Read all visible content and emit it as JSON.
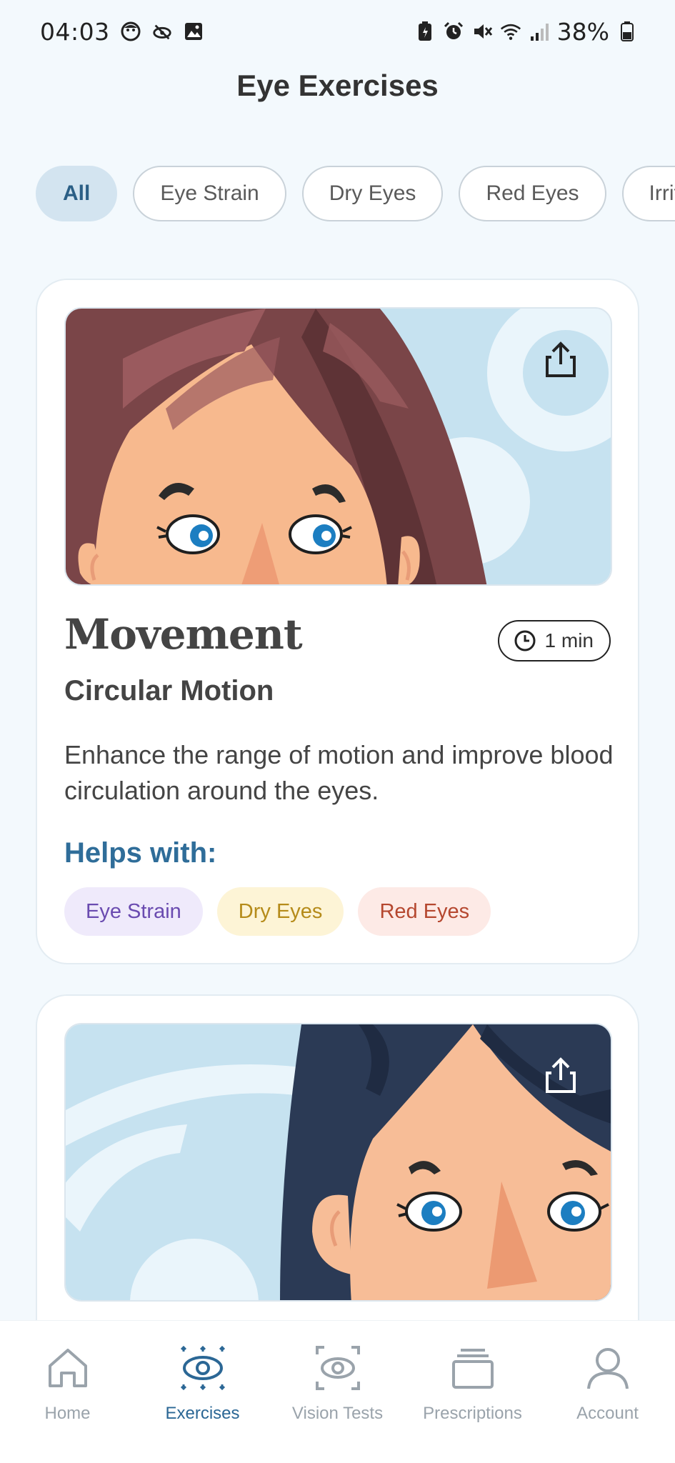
{
  "status_bar": {
    "time": "04:03",
    "battery": "38%"
  },
  "header": {
    "title": "Eye Exercises"
  },
  "filters": [
    {
      "label": "All",
      "active": true
    },
    {
      "label": "Eye Strain",
      "active": false
    },
    {
      "label": "Dry Eyes",
      "active": false
    },
    {
      "label": "Red Eyes",
      "active": false
    },
    {
      "label": "Irrita",
      "active": false
    }
  ],
  "cards": [
    {
      "title": "Movement",
      "subtitle": "Circular Motion",
      "duration": "1 min",
      "description": "Enhance the range of motion and improve blood circulation around the eyes.",
      "helps_label": "Helps with:",
      "tags": [
        "Eye Strain",
        "Dry Eyes",
        "Red Eyes"
      ]
    }
  ],
  "bottom_nav": [
    {
      "label": "Home",
      "icon": "home-icon",
      "active": false
    },
    {
      "label": "Exercises",
      "icon": "eye-exercise-icon",
      "active": true
    },
    {
      "label": "Vision Tests",
      "icon": "vision-test-icon",
      "active": false
    },
    {
      "label": "Prescriptions",
      "icon": "prescriptions-icon",
      "active": false
    },
    {
      "label": "Account",
      "icon": "account-icon",
      "active": false
    }
  ],
  "colors": {
    "accent": "#2b6795",
    "background": "#f3f9fd",
    "tag_strain": "#6a4bb0",
    "tag_dry": "#b58b1a",
    "tag_red": "#b5472f"
  }
}
